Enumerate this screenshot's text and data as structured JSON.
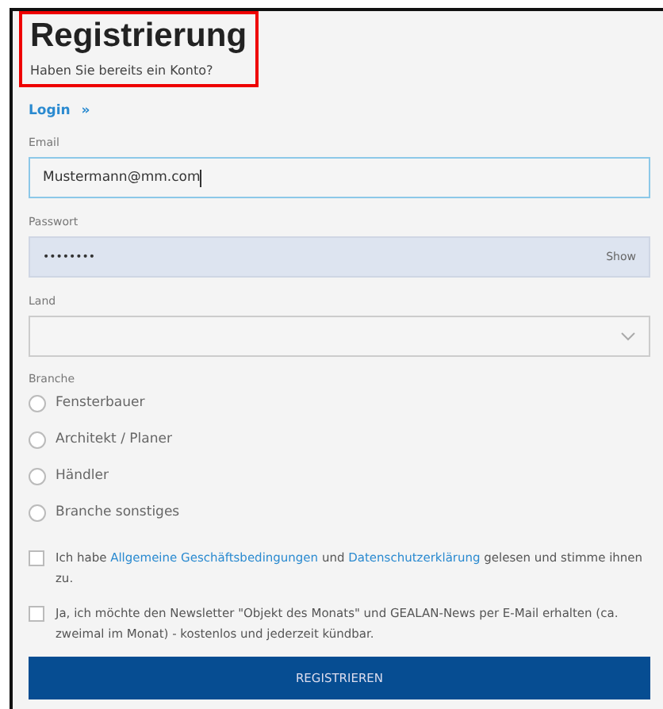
{
  "title": "Registrierung",
  "subtitle": "Haben Sie bereits ein Konto?",
  "highlighted": true,
  "login_link": {
    "label": "Login",
    "icon": "»"
  },
  "fields": [
    {
      "kind": "text",
      "label": "Email",
      "value": "Mustermann@mm.com",
      "focused": true
    },
    {
      "kind": "password",
      "label": "Passwort",
      "value": "••••••••",
      "toggle": "Show"
    },
    {
      "kind": "select",
      "label": "Land"
    }
  ],
  "branche": {
    "label": "Branche",
    "options": [
      {
        "label": "Fensterbauer",
        "selected": false
      },
      {
        "label": "Architekt / Planer",
        "selected": false
      },
      {
        "label": "Händler",
        "selected": false
      },
      {
        "label": "Branche sonstiges",
        "selected": false
      }
    ]
  },
  "consents": [
    {
      "checked": false,
      "parts": [
        {
          "text": "Ich habe "
        },
        {
          "link": "Allgemeine Geschäftsbedingungen"
        },
        {
          "text": " und "
        },
        {
          "link": "Datenschutzerklärung"
        },
        {
          "text": " gelesen und stimme ihnen zu."
        }
      ]
    },
    {
      "checked": false,
      "parts": [
        {
          "text": "Ja, ich möchte den Newsletter \"Objekt des Monats\" und GEALAN-News per E-Mail erhalten (ca. zweimal im Monat) - kostenlos und jederzeit kündbar."
        }
      ]
    }
  ],
  "submit": "REGISTRIEREN"
}
